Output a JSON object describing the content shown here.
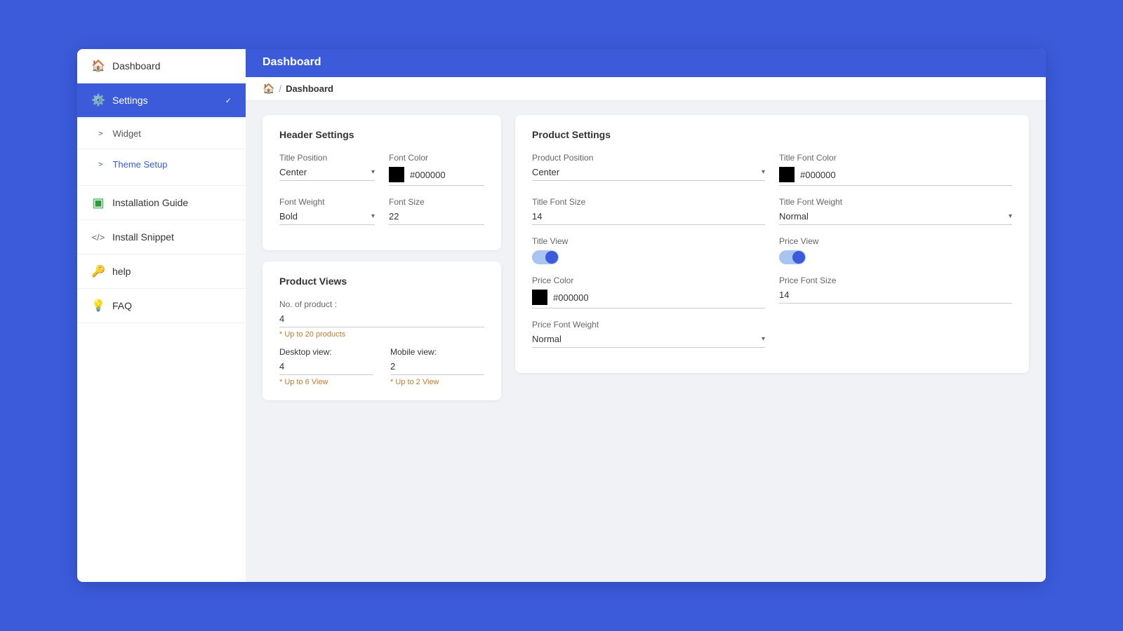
{
  "topbar": {
    "title": "Dashboard"
  },
  "breadcrumb": {
    "home_icon": "🏠",
    "separator": "/",
    "current": "Dashboard"
  },
  "sidebar": {
    "items": [
      {
        "id": "dashboard",
        "label": "Dashboard",
        "icon": "🏠",
        "active": false
      },
      {
        "id": "settings",
        "label": "Settings",
        "icon": "⚙️",
        "active": true,
        "has_chevron": true
      },
      {
        "id": "widget",
        "label": "Widget",
        "arrow": ">",
        "sub": true
      },
      {
        "id": "theme-setup",
        "label": "Theme Setup",
        "arrow": ">",
        "sub": true,
        "highlighted": true
      },
      {
        "id": "installation-guide",
        "label": "Installation Guide",
        "icon": "🟩",
        "active": false
      },
      {
        "id": "install-snippet",
        "label": "Install Snippet",
        "icon": "⟨/⟩",
        "active": false
      },
      {
        "id": "help",
        "label": "help",
        "icon": "🔑",
        "active": false
      },
      {
        "id": "faq",
        "label": "FAQ",
        "icon": "💡",
        "active": false
      }
    ]
  },
  "header_settings": {
    "card_title": "Header Settings",
    "title_position_label": "Title Position",
    "title_position_value": "Center",
    "font_color_label": "Font Color",
    "font_color_hex": "#000000",
    "font_weight_label": "Font Weight",
    "font_weight_value": "Bold",
    "font_size_label": "Font Size",
    "font_size_value": "22"
  },
  "product_views": {
    "card_title": "Product Views",
    "no_of_product_label": "No. of product :",
    "no_of_product_value": "4",
    "no_of_product_hint": "* Up to 20 products",
    "desktop_view_label": "Desktop view:",
    "desktop_view_value": "4",
    "desktop_view_hint": "* Up to 6 View",
    "mobile_view_label": "Mobile view:",
    "mobile_view_value": "2",
    "mobile_view_hint": "* Up to 2 View"
  },
  "product_settings": {
    "card_title": "Product Settings",
    "product_position_label": "Product Position",
    "product_position_value": "Center",
    "title_font_color_label": "Title Font Color",
    "title_font_color_hex": "#000000",
    "title_font_size_label": "Title Font Size",
    "title_font_size_value": "14",
    "title_font_weight_label": "Title Font Weight",
    "title_font_weight_value": "Normal",
    "title_view_label": "Title View",
    "price_view_label": "Price View",
    "price_color_label": "Price Color",
    "price_color_hex": "#000000",
    "price_font_size_label": "Price Font Size",
    "price_font_size_value": "14",
    "price_font_weight_label": "Price Font Weight",
    "price_font_weight_value": "Normal"
  }
}
